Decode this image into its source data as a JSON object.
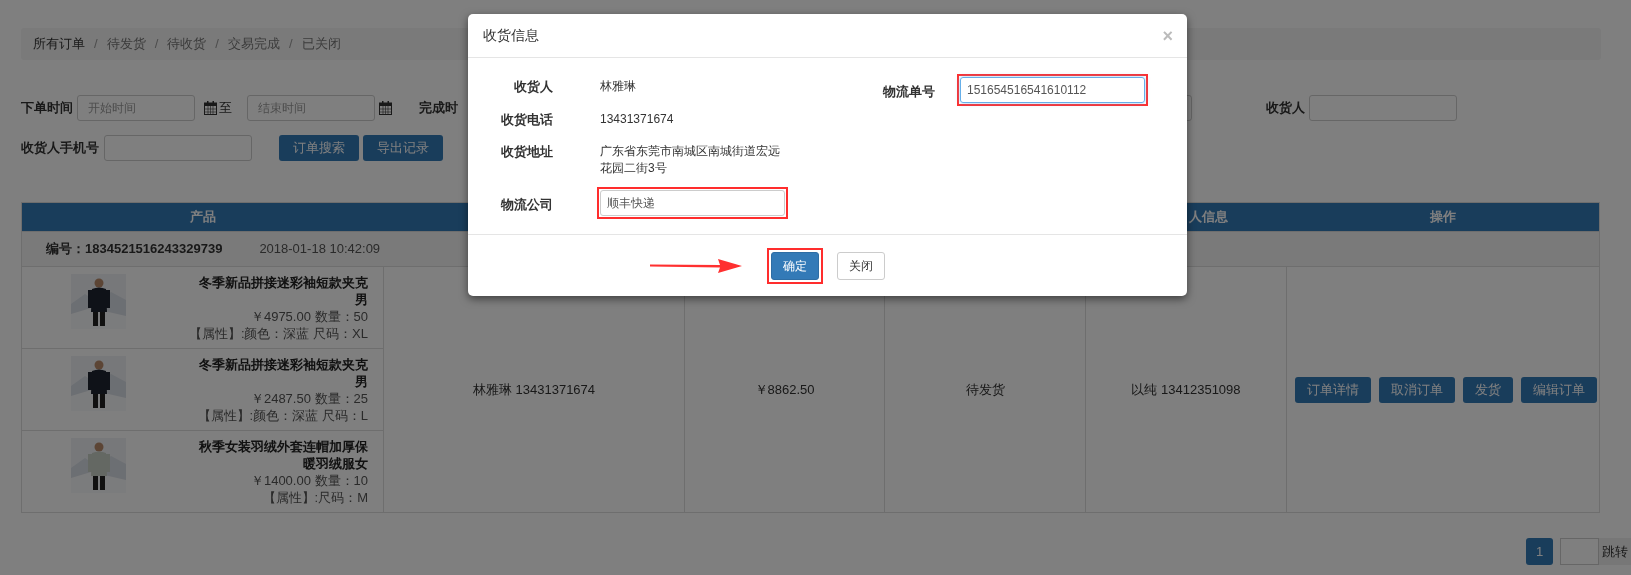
{
  "breadcrumb": [
    {
      "label": "所有订单",
      "selected": true
    },
    {
      "separator": "/",
      "label": "待发货",
      "selected": false
    },
    {
      "separator": "/",
      "label": "待收货",
      "selected": false
    },
    {
      "separator": "/",
      "label": "交易完成",
      "selected": false
    },
    {
      "separator": "/",
      "label": "已关闭",
      "selected": false
    }
  ],
  "filters": {
    "order_time_label": "下单时间",
    "start_placeholder": "开始时间",
    "separator": "至",
    "end_placeholder": "结束时间",
    "finish_time_label": "完成时",
    "receiver_label": "收货人",
    "phone_label": "收货人手机号",
    "buttons": [
      "订单搜索",
      "导出记录"
    ]
  },
  "table": {
    "header": {
      "column_1": "产品",
      "column_5": "人信息",
      "column_6": "操作"
    },
    "order": {
      "number_label": "编号：",
      "number": "1834521516243329739",
      "time": "2018-01-18 10:42:09",
      "products": [
        {
          "name": "冬季新品拼接迷彩袖短款夹克男",
          "price_line": "￥4975.00 数量：50",
          "attributes": "【属性】:颜色：深蓝 尺码：XL"
        },
        {
          "name": "冬季新品拼接迷彩袖短款夹克男",
          "price_line": "￥2487.50 数量：25",
          "attributes": "【属性】:颜色：深蓝 尺码：L"
        },
        {
          "name": "秋季女装羽绒外套连帽加厚保暖羽绒服女",
          "price_line": "￥1400.00 数量：10",
          "attributes": "【属性】:尺码：M"
        }
      ],
      "receiver": "林雅琳 13431371674",
      "amount": "￥8862.50",
      "status": "待发货",
      "buyer": "以纯 13412351098",
      "actions": [
        "订单详情",
        "取消订单",
        "发货",
        "编辑订单"
      ]
    }
  },
  "pagination": {
    "pages": [
      {
        "label": "1",
        "selected": true
      }
    ],
    "jump_label": "跳转"
  },
  "modal": {
    "title": "收货信息",
    "close": "×",
    "left_fields": [
      {
        "kind": "text",
        "label": "收货人",
        "value": "林雅琳"
      },
      {
        "kind": "text",
        "label": "收货电话",
        "value": "13431371674"
      },
      {
        "kind": "text",
        "label": "收货地址",
        "value": "广东省东莞市南城区南城街道宏远花园二街3号"
      },
      {
        "kind": "input",
        "label": "物流公司",
        "value": "顺丰快递",
        "highlighted": true
      }
    ],
    "right_fields": [
      {
        "kind": "input",
        "label": "物流单号",
        "value": "151654516541610112",
        "highlighted": true,
        "focused": true
      }
    ],
    "buttons": [
      {
        "kind": "primary",
        "label": "确定",
        "highlighted": true
      },
      {
        "kind": "default",
        "label": "关闭",
        "highlighted": false
      }
    ]
  }
}
